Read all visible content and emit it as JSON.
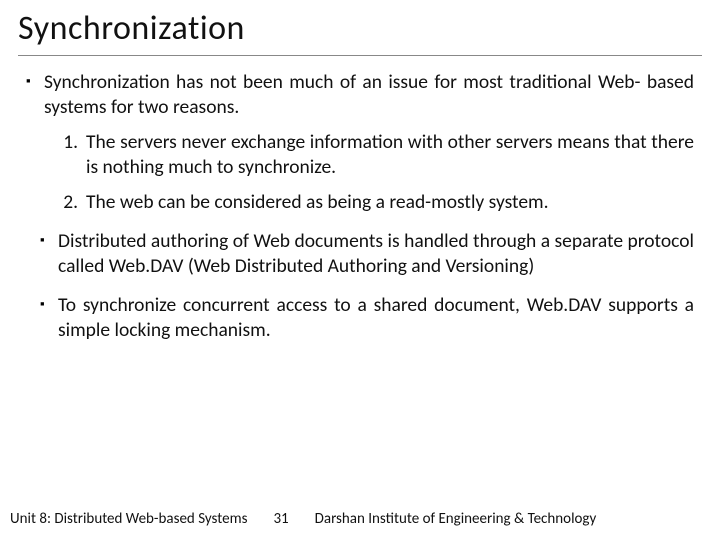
{
  "title": "Synchronization",
  "bullets": [
    "Synchronization has not been much of an issue for most traditional Web- based systems for two reasons."
  ],
  "numbered": [
    "The servers never exchange information with other servers means that there is nothing much to synchronize.",
    "The web can be considered as being a read-mostly system."
  ],
  "bullets_after": [
    "Distributed authoring of Web documents is handled through a separate protocol called Web.DAV (Web Distributed Authoring and Versioning)",
    "To synchronize concurrent access to a shared document, Web.DAV supports a simple locking mechanism."
  ],
  "footer": {
    "left": "Unit 8: Distributed Web-based Systems",
    "page": "31",
    "right": "Darshan Institute of Engineering & Technology"
  }
}
